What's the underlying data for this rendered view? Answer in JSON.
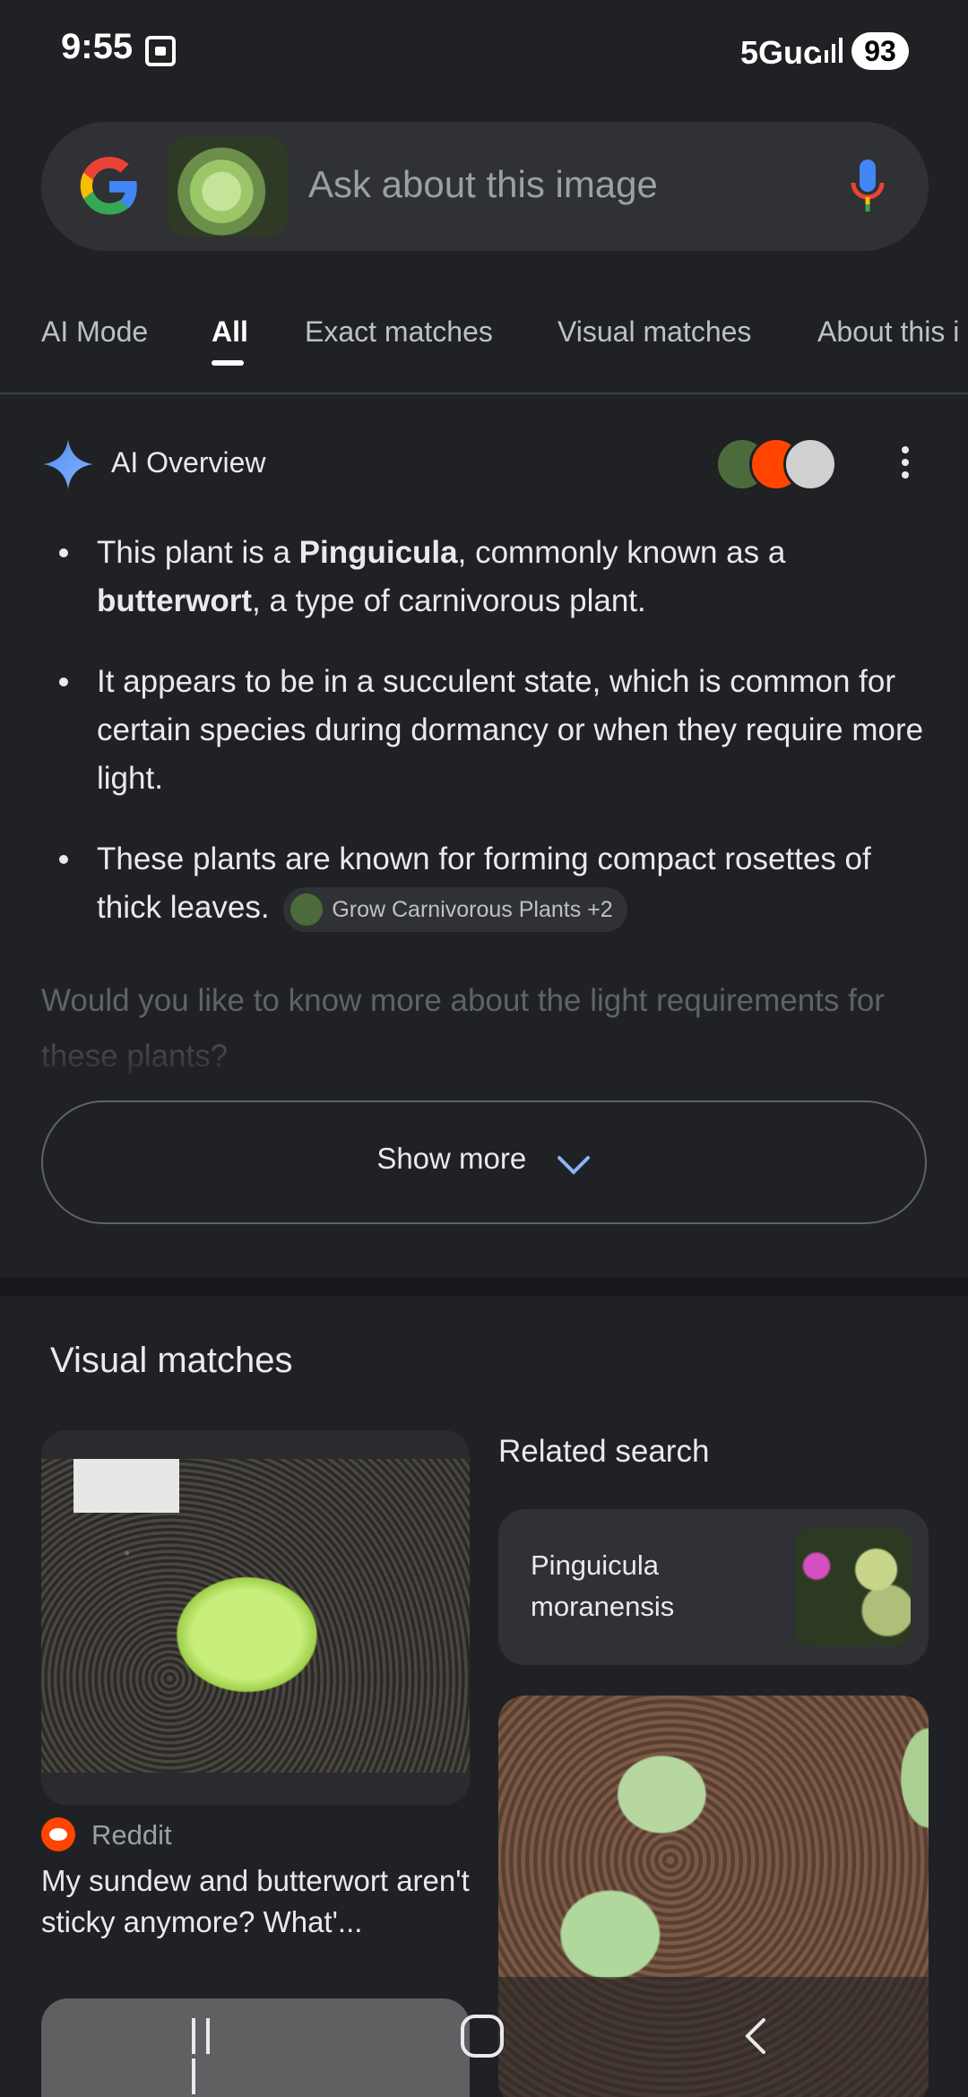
{
  "status": {
    "time": "9:55",
    "network": "5Guc",
    "battery": "93"
  },
  "search": {
    "placeholder": "Ask about this image"
  },
  "tabs": [
    {
      "label": "AI Mode"
    },
    {
      "label": "All"
    },
    {
      "label": "Exact matches"
    },
    {
      "label": "Visual matches"
    },
    {
      "label": "About this i"
    }
  ],
  "ai_overview": {
    "title": "AI Overview",
    "bullets": [
      {
        "pre": "This plant is a ",
        "bold1": "Pinguicula",
        "mid": ", commonly known as a ",
        "bold2": "butterwort",
        "post": ", a type of carnivorous plant."
      },
      {
        "text": "It appears to be in a succulent state, which is common for certain species during dormancy or when they require more light."
      },
      {
        "text": "These plants are known for forming compact rosettes of thick leaves."
      }
    ],
    "source_chip": "Grow Carnivorous Plants +2",
    "followup": "Would you like to know more about the light requirements for these plants?",
    "show_more": "Show more"
  },
  "visual_matches": {
    "title": "Visual matches",
    "left_card": {
      "source": "Reddit",
      "caption": "My sundew and butterwort aren't sticky anymore? What'..."
    },
    "related": {
      "title": "Related search",
      "label": "Pinguicula moranensis"
    }
  },
  "colors": {
    "background": "#202124",
    "surface": "#303134",
    "accent_blue": "#8ab4f8"
  }
}
